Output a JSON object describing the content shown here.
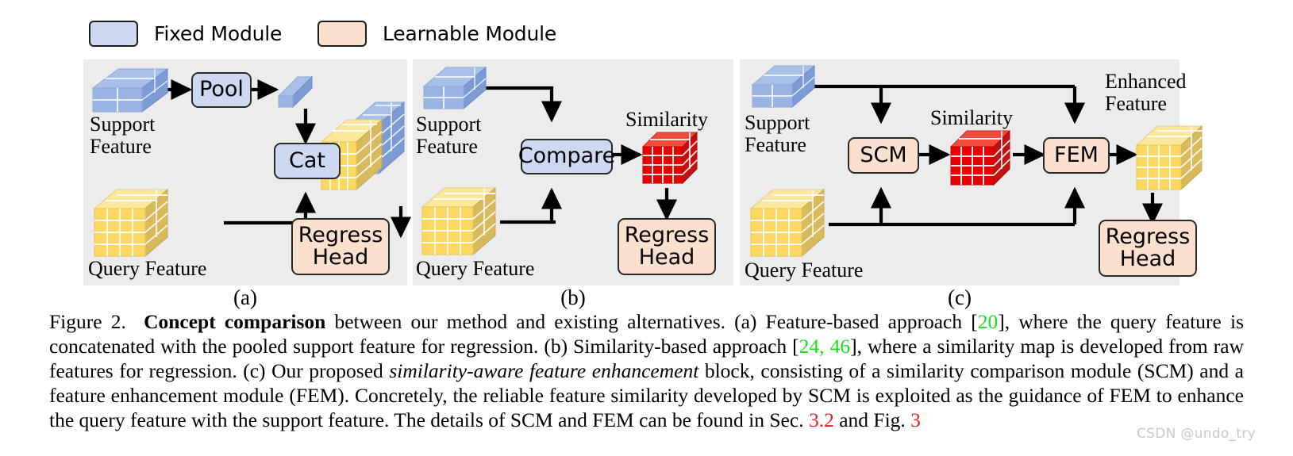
{
  "legend": {
    "items": [
      {
        "label": "Fixed Module",
        "color": "#ccd9f0",
        "kind": "fixed"
      },
      {
        "label": "Learnable Module",
        "color": "#fbe0cd",
        "kind": "learnable"
      }
    ]
  },
  "panels": [
    {
      "id": "a",
      "caption": "(a)",
      "labels": {
        "support": "Support\nFeature",
        "query": "Query Feature"
      },
      "modules": [
        {
          "name": "pool",
          "label": "Pool",
          "kind": "fixed"
        },
        {
          "name": "cat",
          "label": "Cat",
          "kind": "fixed"
        },
        {
          "name": "regress-head",
          "label": "Regress\nHead",
          "kind": "learnable"
        }
      ],
      "tensors": [
        {
          "name": "support-feature",
          "color": "#92aee0"
        },
        {
          "name": "pooled-support-vector",
          "color": "#92aee0"
        },
        {
          "name": "query-feature",
          "color": "#fcd862"
        },
        {
          "name": "concatenated-feature",
          "color": "#fcd862"
        }
      ]
    },
    {
      "id": "b",
      "caption": "(b)",
      "labels": {
        "support": "Support\nFeature",
        "query": "Query Feature",
        "similarity": "Similarity"
      },
      "modules": [
        {
          "name": "compare",
          "label": "Compare",
          "kind": "fixed"
        },
        {
          "name": "regress-head",
          "label": "Regress\nHead",
          "kind": "learnable"
        }
      ],
      "tensors": [
        {
          "name": "support-feature",
          "color": "#92aee0"
        },
        {
          "name": "query-feature",
          "color": "#fcd862"
        },
        {
          "name": "similarity-map",
          "color": "#e60000"
        }
      ]
    },
    {
      "id": "c",
      "caption": "(c)",
      "labels": {
        "support": "Support\nFeature",
        "query": "Query Feature",
        "similarity": "Similarity",
        "enhanced": "Enhanced\nFeature"
      },
      "modules": [
        {
          "name": "scm",
          "label": "SCM",
          "kind": "learnable"
        },
        {
          "name": "fem",
          "label": "FEM",
          "kind": "learnable"
        },
        {
          "name": "regress-head",
          "label": "Regress\nHead",
          "kind": "learnable"
        }
      ],
      "tensors": [
        {
          "name": "support-feature",
          "color": "#92aee0"
        },
        {
          "name": "query-feature",
          "color": "#fcd862"
        },
        {
          "name": "similarity-map",
          "color": "#e60000"
        },
        {
          "name": "enhanced-feature",
          "color": "#fcd862"
        }
      ]
    }
  ],
  "caption": {
    "figure_number": "Figure 2.",
    "title": "Concept comparison",
    "seg1": " between our method and existing alternatives. (a) Feature-based approach [",
    "cite1": "20",
    "seg2": "], where the query feature is concatenated with the pooled support feature for regression. (b) Similarity-based approach [",
    "cite2": "24, 46",
    "seg3": "], where a similarity map is developed from raw features for regression. (c) Our proposed ",
    "italic1": "similarity-aware feature enhancement",
    "seg4": " block, consisting of a similarity comparison module (SCM) and a feature enhancement module (FEM). Concretely, the reliable feature similarity developed by SCM is exploited as the guidance of FEM to enhance the query feature with the support feature. The details of SCM and FEM can be found in Sec. ",
    "cite3": "3.2",
    "seg5": " and Fig. ",
    "cite4": "3"
  },
  "watermark": "CSDN @undo_try",
  "colors": {
    "fixed_module": "#ccd9f0",
    "learnable_module": "#fbe0cd",
    "panel_bg": "#ececec",
    "support_blue": "#92aee0",
    "query_yellow": "#fcd862",
    "similarity_red": "#e60000",
    "cite_green": "#18e018",
    "cite_red": "#e82020"
  }
}
